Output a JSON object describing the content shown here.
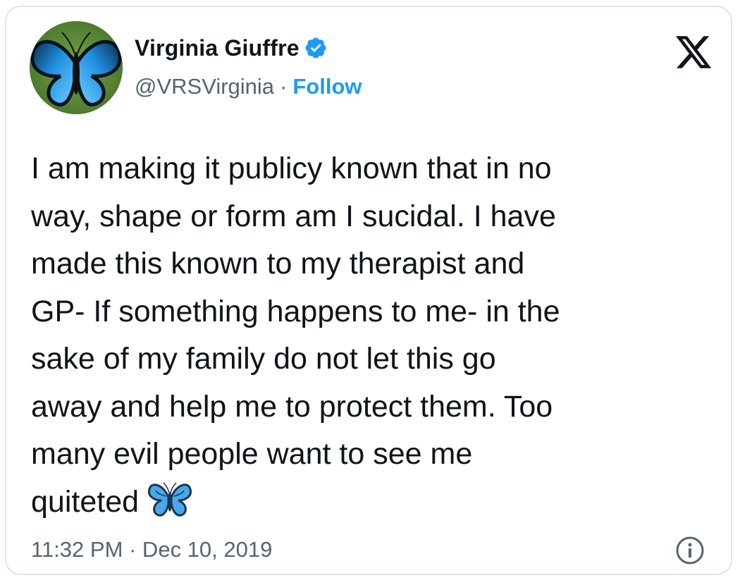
{
  "author": {
    "display_name": "Virginia Giuffre",
    "handle": "@VRSVirginia",
    "verified": true,
    "avatar_icon": "blue-butterfly"
  },
  "header": {
    "separator": "·",
    "follow_label": "Follow",
    "platform_logo": "x-logo"
  },
  "tweet": {
    "lines": [
      "I am making it publicy known that in no",
      "way, shape or form am I sucidal. I have",
      "made this known to my therapist and",
      "GP- If something happens to me- in the",
      "sake of my family do not let this go",
      "away and help me to protect them. Too",
      "many evil people want to see me",
      "quiteted"
    ],
    "emoji": "blue-butterfly-emoji"
  },
  "footer": {
    "timestamp": "11:32 PM · Dec 10, 2019",
    "info_icon": "info-icon"
  },
  "colors": {
    "text": "#0f1419",
    "muted": "#536471",
    "accent": "#1d9bf0",
    "border": "#dfe3e7"
  }
}
